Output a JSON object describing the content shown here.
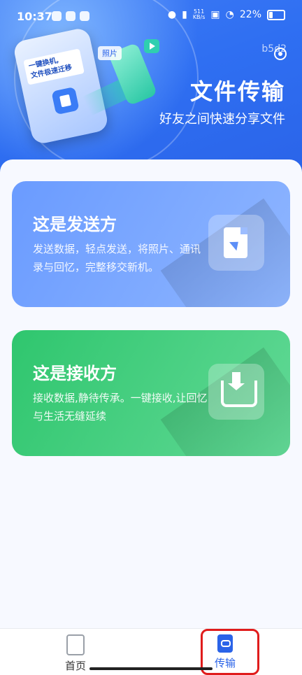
{
  "status_bar": {
    "time": "10:37",
    "network_speed_value": "511",
    "network_speed_unit": "KB/s",
    "battery": "22%"
  },
  "hero": {
    "phone_card_line1": "一键换机,",
    "phone_card_line2": "文件极速迁移",
    "photo_tag": "照片",
    "user_id": "b5d2",
    "title": "文件传输",
    "subtitle": "好友之间快速分享文件"
  },
  "cards": {
    "send": {
      "title": "这是发送方",
      "description": "发送数据，轻点发送，将照片、通讯录与回忆，完整移交新机。",
      "icon": "file-send-icon",
      "color": "#7aa6ff"
    },
    "receive": {
      "title": "这是接收方",
      "description": "接收数据,静待传承。一键接收,让回忆与生活无缝延续",
      "icon": "inbox-download-icon",
      "color": "#3fcf7e"
    }
  },
  "tabbar": {
    "home_label": "首页",
    "transfer_label": "传输",
    "active": "传输",
    "accent": "#2a63e8"
  }
}
